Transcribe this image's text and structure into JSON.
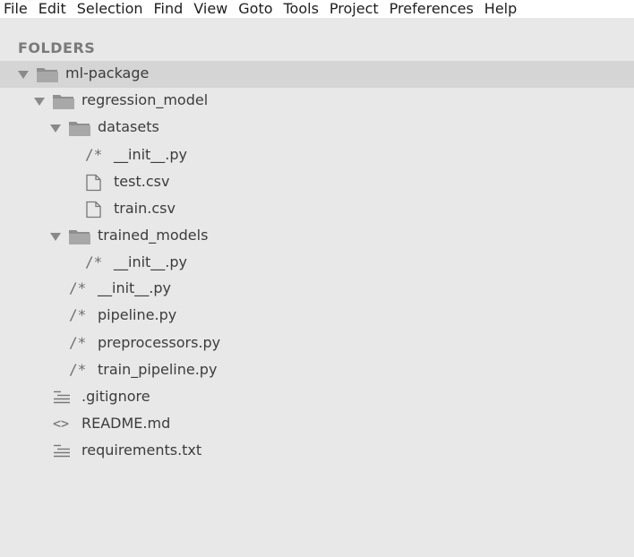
{
  "menu": [
    "File",
    "Edit",
    "Selection",
    "Find",
    "View",
    "Goto",
    "Tools",
    "Project",
    "Preferences",
    "Help"
  ],
  "sidebar": {
    "header": "FOLDERS",
    "tree": [
      {
        "label": "ml-package",
        "type": "folder",
        "icon": "folder-open-icon"
      },
      {
        "label": "regression_model",
        "type": "folder",
        "icon": "folder-open-icon"
      },
      {
        "label": "datasets",
        "type": "folder",
        "icon": "folder-open-icon"
      },
      {
        "label": "__init__.py",
        "type": "python",
        "icon": "comment-icon"
      },
      {
        "label": "test.csv",
        "type": "file",
        "icon": "file-icon"
      },
      {
        "label": "train.csv",
        "type": "file",
        "icon": "file-icon"
      },
      {
        "label": "trained_models",
        "type": "folder",
        "icon": "folder-open-icon"
      },
      {
        "label": "__init__.py",
        "type": "python",
        "icon": "comment-icon"
      },
      {
        "label": "__init__.py",
        "type": "python",
        "icon": "comment-icon"
      },
      {
        "label": "pipeline.py",
        "type": "python",
        "icon": "comment-icon"
      },
      {
        "label": "preprocessors.py",
        "type": "python",
        "icon": "comment-icon"
      },
      {
        "label": "train_pipeline.py",
        "type": "python",
        "icon": "comment-icon"
      },
      {
        "label": ".gitignore",
        "type": "text",
        "icon": "lines-icon"
      },
      {
        "label": "README.md",
        "type": "markup",
        "icon": "code-icon"
      },
      {
        "label": "requirements.txt",
        "type": "text",
        "icon": "lines-icon"
      }
    ]
  },
  "glyphs": {
    "comment": "/*",
    "code": "<>"
  }
}
